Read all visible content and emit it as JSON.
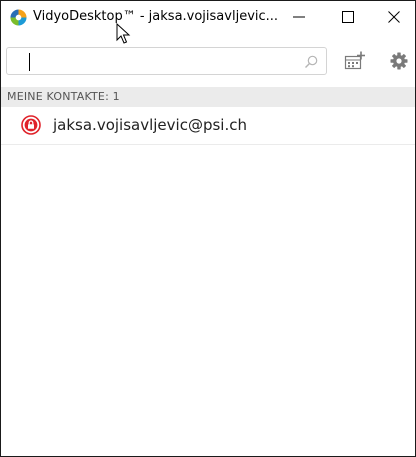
{
  "window": {
    "title": "VidyoDesktop™ - jaksa.vojisavljevic...",
    "minimize_symbol": "—",
    "maximize_symbol": "☐",
    "close_symbol": "✕"
  },
  "toolbar": {
    "search_value": "",
    "search_icon": "search-icon",
    "add_contact_icon": "add-contact-icon",
    "settings_icon": "gear-icon"
  },
  "contacts": {
    "section_label": "MEINE KONTAKTE: 1",
    "items": [
      {
        "name": "jaksa.vojisavljevic@psi.ch",
        "status": "locked-offline",
        "status_color": "#e0222a"
      }
    ]
  },
  "colors": {
    "status_red": "#e0222a",
    "section_bg": "#ebebeb",
    "icon_gray": "#7a7a7a"
  }
}
